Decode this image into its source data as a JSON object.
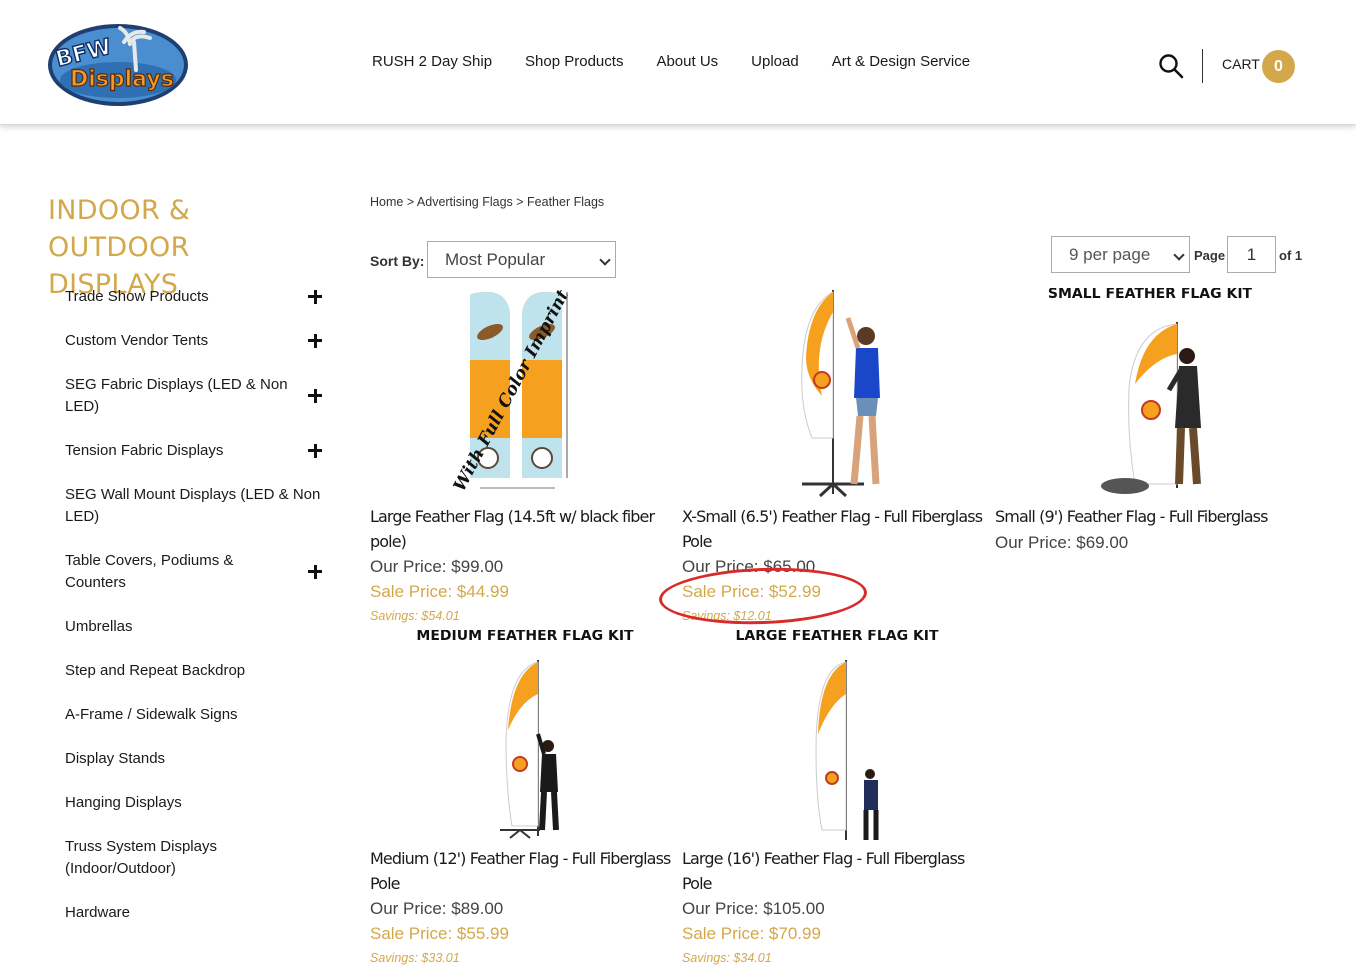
{
  "header": {
    "logo_text": "BFW Displays",
    "nav": [
      "RUSH 2 Day Ship",
      "Shop Products",
      "About Us",
      "Upload",
      "Art & Design Service"
    ],
    "cart_label": "CART",
    "cart_count": "0",
    "accent_color": "#d3a84a"
  },
  "sidebar": {
    "title": "INDOOR & OUTDOOR DISPLAYS",
    "items": [
      {
        "label": "Trade Show Products",
        "expandable": true
      },
      {
        "label": "Custom Vendor Tents",
        "expandable": true
      },
      {
        "label": "SEG Fabric Displays (LED & Non LED)",
        "expandable": true
      },
      {
        "label": "Tension Fabric Displays",
        "expandable": true
      },
      {
        "label": "SEG Wall Mount Displays (LED & Non LED)",
        "expandable": false
      },
      {
        "label": "Table Covers, Podiums & Counters",
        "expandable": true
      },
      {
        "label": "Umbrellas",
        "expandable": false
      },
      {
        "label": "Step and Repeat Backdrop",
        "expandable": false
      },
      {
        "label": "A-Frame / Sidewalk Signs",
        "expandable": false
      },
      {
        "label": "Display Stands",
        "expandable": false
      },
      {
        "label": "Hanging Displays",
        "expandable": false
      },
      {
        "label": "Truss System Displays (Indoor/Outdoor)",
        "expandable": false
      },
      {
        "label": "Hardware",
        "expandable": false
      }
    ]
  },
  "breadcrumb": [
    "Home",
    "Advertising Flags",
    "Feather Flags"
  ],
  "toolbar": {
    "sort_label": "Sort By:",
    "sort_value": "Most Popular",
    "per_page_value": "9 per page",
    "page_label": "Page",
    "page_value": "1",
    "of_label": "of 1"
  },
  "products": [
    {
      "name": "Large Feather Flag (14.5ft w/ black fiber pole)",
      "our_price": "Our Price: $99.00",
      "sale_price": "Sale Price: $44.99",
      "savings": "Savings: $54.01",
      "image_caption": ""
    },
    {
      "name": "X-Small (6.5') Feather Flag - Full Fiberglass Pole",
      "our_price": "Our Price: $65.00",
      "sale_price": "Sale Price: $52.99",
      "savings": "Savings: $12.01",
      "image_caption": ""
    },
    {
      "name": "Small (9') Feather Flag - Full Fiberglass",
      "our_price": "Our Price: $69.00",
      "sale_price": "",
      "savings": "",
      "image_caption": "SMALL FEATHER FLAG KIT"
    },
    {
      "name": "Medium (12') Feather Flag - Full Fiberglass Pole",
      "our_price": "Our Price: $89.00",
      "sale_price": "Sale Price: $55.99",
      "savings": "Savings: $33.01",
      "image_caption": "MEDIUM FEATHER FLAG KIT"
    },
    {
      "name": "Large (16') Feather Flag - Full Fiberglass Pole",
      "our_price": "Our Price: $105.00",
      "sale_price": "Sale Price: $70.99",
      "savings": "Savings: $34.01",
      "image_caption": "LARGE FEATHER FLAG KIT"
    }
  ],
  "flag_imprint_text": "With Full Color Imprint"
}
